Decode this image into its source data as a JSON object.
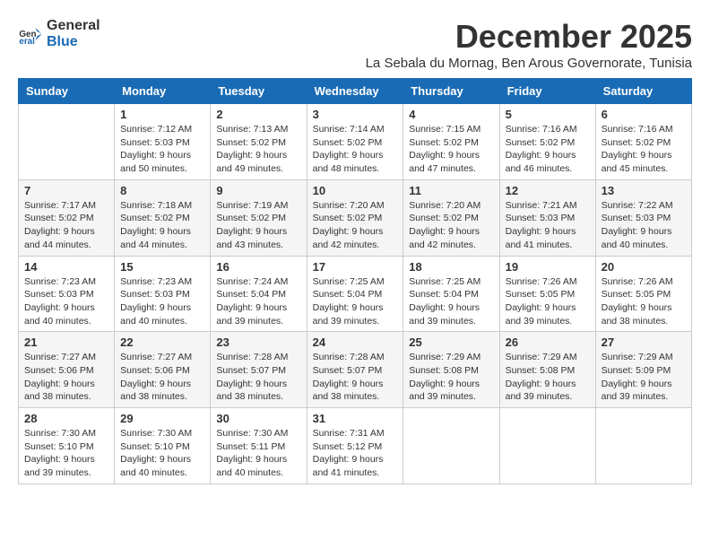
{
  "logo": {
    "line1": "General",
    "line2": "Blue"
  },
  "title": "December 2025",
  "subtitle": "La Sebala du Mornag, Ben Arous Governorate, Tunisia",
  "days_of_week": [
    "Sunday",
    "Monday",
    "Tuesday",
    "Wednesday",
    "Thursday",
    "Friday",
    "Saturday"
  ],
  "weeks": [
    [
      {
        "day": "",
        "info": ""
      },
      {
        "day": "1",
        "info": "Sunrise: 7:12 AM\nSunset: 5:03 PM\nDaylight: 9 hours\nand 50 minutes."
      },
      {
        "day": "2",
        "info": "Sunrise: 7:13 AM\nSunset: 5:02 PM\nDaylight: 9 hours\nand 49 minutes."
      },
      {
        "day": "3",
        "info": "Sunrise: 7:14 AM\nSunset: 5:02 PM\nDaylight: 9 hours\nand 48 minutes."
      },
      {
        "day": "4",
        "info": "Sunrise: 7:15 AM\nSunset: 5:02 PM\nDaylight: 9 hours\nand 47 minutes."
      },
      {
        "day": "5",
        "info": "Sunrise: 7:16 AM\nSunset: 5:02 PM\nDaylight: 9 hours\nand 46 minutes."
      },
      {
        "day": "6",
        "info": "Sunrise: 7:16 AM\nSunset: 5:02 PM\nDaylight: 9 hours\nand 45 minutes."
      }
    ],
    [
      {
        "day": "7",
        "info": "Sunrise: 7:17 AM\nSunset: 5:02 PM\nDaylight: 9 hours\nand 44 minutes."
      },
      {
        "day": "8",
        "info": "Sunrise: 7:18 AM\nSunset: 5:02 PM\nDaylight: 9 hours\nand 44 minutes."
      },
      {
        "day": "9",
        "info": "Sunrise: 7:19 AM\nSunset: 5:02 PM\nDaylight: 9 hours\nand 43 minutes."
      },
      {
        "day": "10",
        "info": "Sunrise: 7:20 AM\nSunset: 5:02 PM\nDaylight: 9 hours\nand 42 minutes."
      },
      {
        "day": "11",
        "info": "Sunrise: 7:20 AM\nSunset: 5:02 PM\nDaylight: 9 hours\nand 42 minutes."
      },
      {
        "day": "12",
        "info": "Sunrise: 7:21 AM\nSunset: 5:03 PM\nDaylight: 9 hours\nand 41 minutes."
      },
      {
        "day": "13",
        "info": "Sunrise: 7:22 AM\nSunset: 5:03 PM\nDaylight: 9 hours\nand 40 minutes."
      }
    ],
    [
      {
        "day": "14",
        "info": "Sunrise: 7:23 AM\nSunset: 5:03 PM\nDaylight: 9 hours\nand 40 minutes."
      },
      {
        "day": "15",
        "info": "Sunrise: 7:23 AM\nSunset: 5:03 PM\nDaylight: 9 hours\nand 40 minutes."
      },
      {
        "day": "16",
        "info": "Sunrise: 7:24 AM\nSunset: 5:04 PM\nDaylight: 9 hours\nand 39 minutes."
      },
      {
        "day": "17",
        "info": "Sunrise: 7:25 AM\nSunset: 5:04 PM\nDaylight: 9 hours\nand 39 minutes."
      },
      {
        "day": "18",
        "info": "Sunrise: 7:25 AM\nSunset: 5:04 PM\nDaylight: 9 hours\nand 39 minutes."
      },
      {
        "day": "19",
        "info": "Sunrise: 7:26 AM\nSunset: 5:05 PM\nDaylight: 9 hours\nand 39 minutes."
      },
      {
        "day": "20",
        "info": "Sunrise: 7:26 AM\nSunset: 5:05 PM\nDaylight: 9 hours\nand 38 minutes."
      }
    ],
    [
      {
        "day": "21",
        "info": "Sunrise: 7:27 AM\nSunset: 5:06 PM\nDaylight: 9 hours\nand 38 minutes."
      },
      {
        "day": "22",
        "info": "Sunrise: 7:27 AM\nSunset: 5:06 PM\nDaylight: 9 hours\nand 38 minutes."
      },
      {
        "day": "23",
        "info": "Sunrise: 7:28 AM\nSunset: 5:07 PM\nDaylight: 9 hours\nand 38 minutes."
      },
      {
        "day": "24",
        "info": "Sunrise: 7:28 AM\nSunset: 5:07 PM\nDaylight: 9 hours\nand 38 minutes."
      },
      {
        "day": "25",
        "info": "Sunrise: 7:29 AM\nSunset: 5:08 PM\nDaylight: 9 hours\nand 39 minutes."
      },
      {
        "day": "26",
        "info": "Sunrise: 7:29 AM\nSunset: 5:08 PM\nDaylight: 9 hours\nand 39 minutes."
      },
      {
        "day": "27",
        "info": "Sunrise: 7:29 AM\nSunset: 5:09 PM\nDaylight: 9 hours\nand 39 minutes."
      }
    ],
    [
      {
        "day": "28",
        "info": "Sunrise: 7:30 AM\nSunset: 5:10 PM\nDaylight: 9 hours\nand 39 minutes."
      },
      {
        "day": "29",
        "info": "Sunrise: 7:30 AM\nSunset: 5:10 PM\nDaylight: 9 hours\nand 40 minutes."
      },
      {
        "day": "30",
        "info": "Sunrise: 7:30 AM\nSunset: 5:11 PM\nDaylight: 9 hours\nand 40 minutes."
      },
      {
        "day": "31",
        "info": "Sunrise: 7:31 AM\nSunset: 5:12 PM\nDaylight: 9 hours\nand 41 minutes."
      },
      {
        "day": "",
        "info": ""
      },
      {
        "day": "",
        "info": ""
      },
      {
        "day": "",
        "info": ""
      }
    ]
  ]
}
